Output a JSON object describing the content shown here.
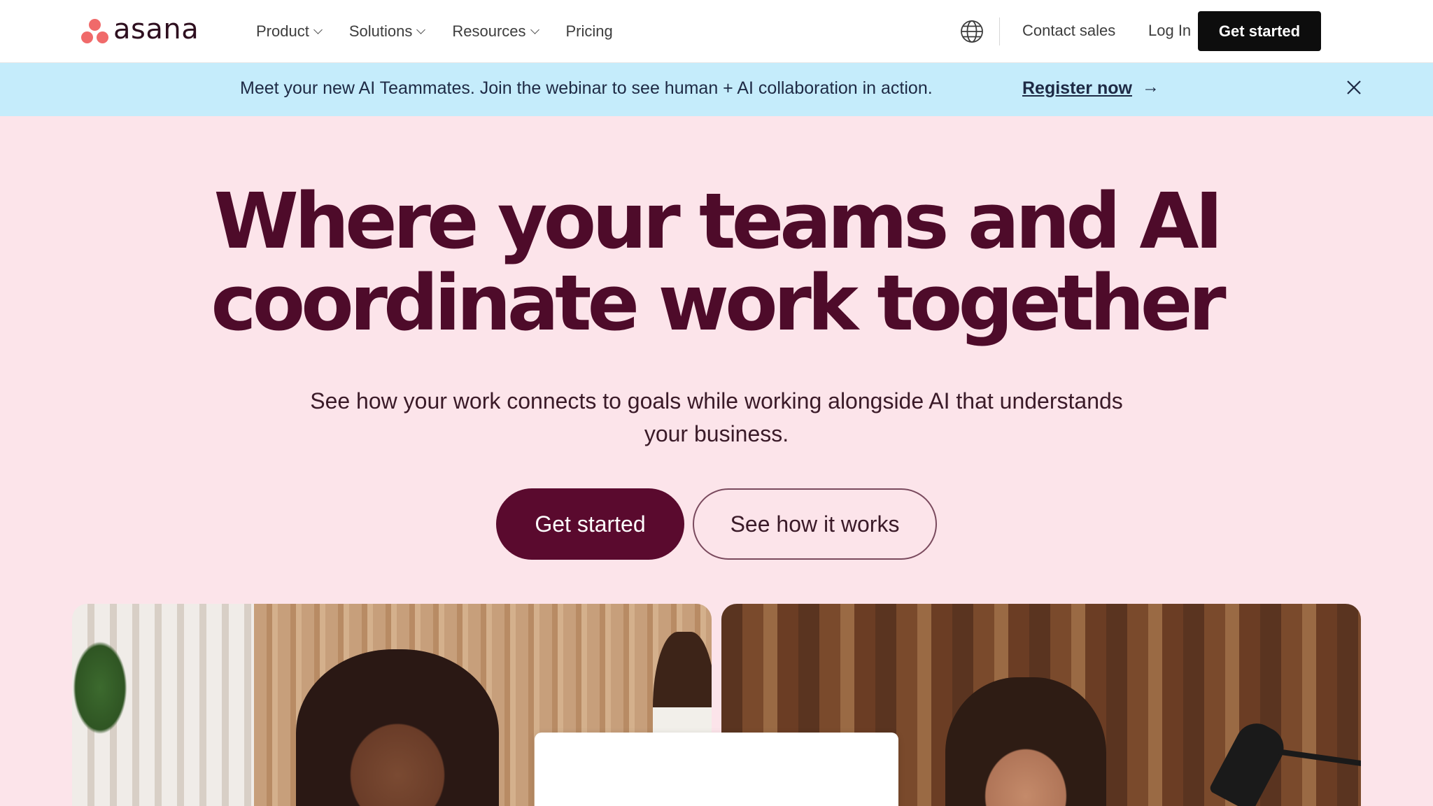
{
  "header": {
    "logo_text": "asana",
    "logo_color": "#f06a6a",
    "nav": [
      {
        "label": "Product",
        "has_dropdown": true
      },
      {
        "label": "Solutions",
        "has_dropdown": true
      },
      {
        "label": "Resources",
        "has_dropdown": true
      },
      {
        "label": "Pricing",
        "has_dropdown": false
      }
    ],
    "language_icon": "globe-icon",
    "contact_sales": "Contact sales",
    "log_in": "Log In",
    "get_started": "Get started"
  },
  "banner": {
    "text": "Meet your new AI Teammates. Join the webinar to see human + AI collaboration in action.",
    "link": "Register now",
    "arrow": "→",
    "close_icon": "close-icon",
    "background": "#c5ecfb"
  },
  "hero": {
    "title_line1": "Where your teams and AI",
    "title_line2": "coordinate work together",
    "subtitle_line1": "See how your work connects to goals while working alongside AI that understands",
    "subtitle_line2": "your business.",
    "primary_cta": "Get started",
    "secondary_cta": "See how it works",
    "background": "#fce4ea",
    "accent": "#5a0a2e"
  }
}
